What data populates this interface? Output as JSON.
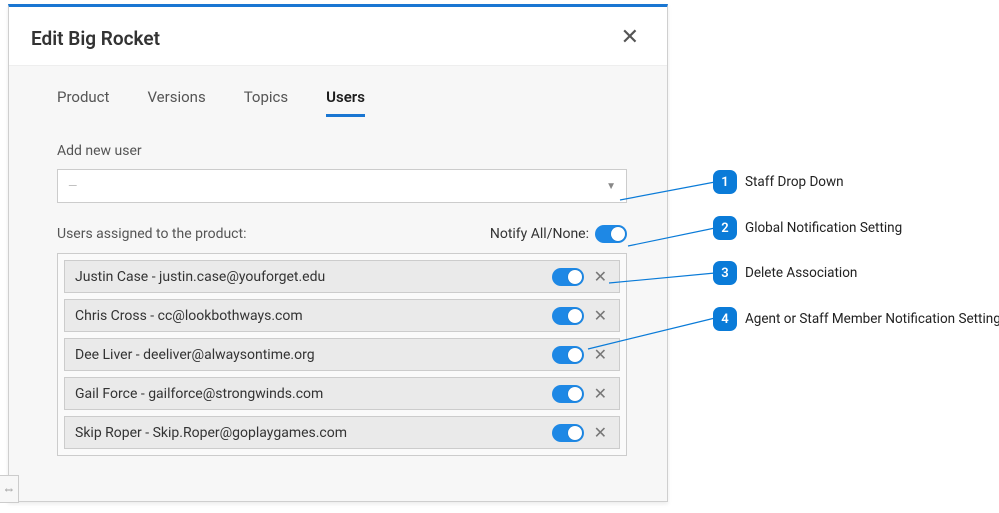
{
  "modal": {
    "title": "Edit Big Rocket",
    "close_glyph": "✕"
  },
  "tabs": [
    {
      "label": "Product",
      "active": false
    },
    {
      "label": "Versions",
      "active": false
    },
    {
      "label": "Topics",
      "active": false
    },
    {
      "label": "Users",
      "active": true
    }
  ],
  "add_user": {
    "label": "Add new user",
    "placeholder": "—",
    "arrow": "▼"
  },
  "assigned": {
    "label": "Users assigned to the product:",
    "notify_label": "Notify All/None:"
  },
  "users": [
    {
      "display": "Justin Case - justin.case@youforget.edu",
      "notify": true
    },
    {
      "display": "Chris Cross - cc@lookbothways.com",
      "notify": true
    },
    {
      "display": "Dee Liver - deeliver@alwaysontime.org",
      "notify": true
    },
    {
      "display": "Gail Force - gailforce@strongwinds.com",
      "notify": true
    },
    {
      "display": "Skip Roper - Skip.Roper@goplaygames.com",
      "notify": true
    }
  ],
  "row_close_glyph": "✕",
  "drag_glyph": "⇔",
  "callouts": [
    {
      "num": "1",
      "text": "Staff Drop Down"
    },
    {
      "num": "2",
      "text": "Global Notification Setting"
    },
    {
      "num": "3",
      "text": "Delete Association"
    },
    {
      "num": "4",
      "text": "Agent or Staff Member Notification Setting"
    }
  ]
}
